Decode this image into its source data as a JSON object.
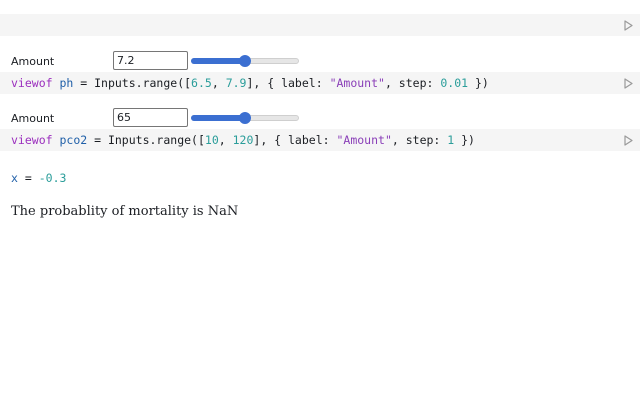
{
  "empty_cell": {},
  "ph": {
    "label": "Amount",
    "value": "7.2",
    "min": 6.5,
    "max": 7.9,
    "code": {
      "kw": "viewof",
      "name": "ph",
      "pre": " = Inputs.range([",
      "min": "6.5",
      "sep": ", ",
      "max": "7.9",
      "mid": "], { label: ",
      "label": "\"Amount\"",
      "mid2": ", step: ",
      "step": "0.01",
      "end": " })"
    }
  },
  "pco2": {
    "label": "Amount",
    "value": "65",
    "min": 10,
    "max": 120,
    "code": {
      "kw": "viewof",
      "name": "pco2",
      "pre": " = Inputs.range([",
      "min": "10",
      "sep": ", ",
      "max": "120",
      "mid": "], { label: ",
      "label": "\"Amount\"",
      "mid2": ", step: ",
      "step": "1",
      "end": " })"
    }
  },
  "output": {
    "name": "x",
    "eq": " = ",
    "value": "-0.3"
  },
  "prose": {
    "text": "The probablity of mortality is NaN"
  },
  "colors": {
    "accent": "#3b6fd1",
    "cell_bg": "#f5f5f5"
  }
}
